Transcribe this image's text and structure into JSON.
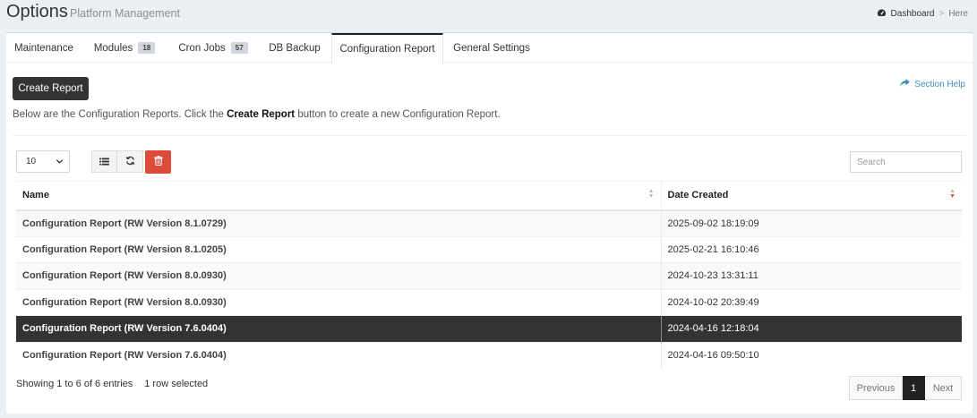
{
  "header": {
    "title": "Options",
    "subtitle": "Platform Management"
  },
  "breadcrumb": {
    "home": "Dashboard",
    "separator": ">",
    "current": "Here"
  },
  "tabs": [
    {
      "label": "Maintenance",
      "badge": "",
      "active": false
    },
    {
      "label": "Modules",
      "badge": "18",
      "active": false
    },
    {
      "label": "Cron Jobs",
      "badge": "57",
      "active": false
    },
    {
      "label": "DB Backup",
      "badge": "",
      "active": false
    },
    {
      "label": "Configuration Report",
      "badge": "",
      "active": true
    },
    {
      "label": "General Settings",
      "badge": "",
      "active": false
    }
  ],
  "actions": {
    "create_label": "Create Report",
    "help_label": "Section Help"
  },
  "description": {
    "prefix": "Below are the Configuration Reports. Click the ",
    "bold": "Create Report",
    "suffix": " button to create a new Configuration Report."
  },
  "toolbar": {
    "page_length": "10",
    "search_placeholder": "Search",
    "icons": [
      "list-icon",
      "refresh-icon",
      "trash-icon"
    ]
  },
  "table": {
    "columns": [
      "Name",
      "Date Created"
    ],
    "sorted_column": "Date Created",
    "sort_direction": "descending",
    "rows": [
      {
        "name": "Configuration Report (RW Version 8.1.0729)",
        "date": "2025-09-02 18:19:09",
        "selected": false
      },
      {
        "name": "Configuration Report (RW Version 8.1.0205)",
        "date": "2025-02-21 16:10:46",
        "selected": false
      },
      {
        "name": "Configuration Report (RW Version 8.0.0930)",
        "date": "2024-10-23 13:31:11",
        "selected": false
      },
      {
        "name": "Configuration Report (RW Version 8.0.0930)",
        "date": "2024-10-02 20:39:49",
        "selected": false
      },
      {
        "name": "Configuration Report (RW Version 7.6.0404)",
        "date": "2024-04-16 12:18:04",
        "selected": true
      },
      {
        "name": "Configuration Report (RW Version 7.6.0404)",
        "date": "2024-04-16 09:50:10",
        "selected": false
      }
    ]
  },
  "footer": {
    "info": "Showing 1 to 6 of 6 entries",
    "selection": "1 row selected",
    "pagination": {
      "previous": "Previous",
      "current": "1",
      "next": "Next"
    }
  },
  "colors": {
    "selected_row": "#333333",
    "delete_button": "#dd4b39",
    "link": "#3c8dbc",
    "primary_button": "#333333"
  }
}
